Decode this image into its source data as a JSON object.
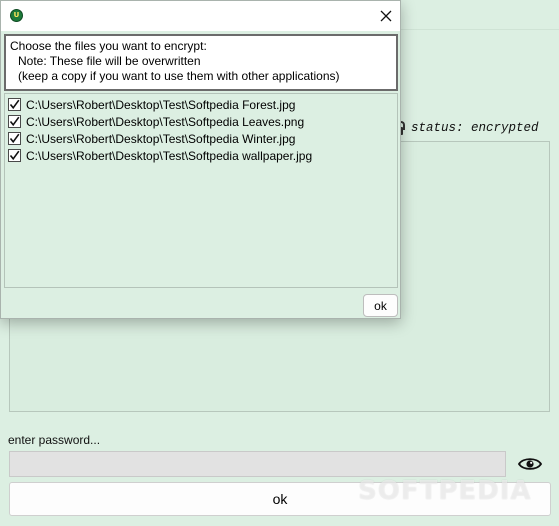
{
  "main": {
    "status_text": "status: encrypted",
    "password_label": "enter password...",
    "password_value": "",
    "ok_label": "ok",
    "watermark": "SOFTPEDIA"
  },
  "dialog": {
    "app_icon_letter": "U",
    "info_lines": [
      "Choose the files you want to encrypt:",
      "Note: These file will be overwritten",
      "(keep a copy if you want to use them with other applications)"
    ],
    "files": [
      {
        "path": "C:\\Users\\Robert\\Desktop\\Test\\Softpedia Forest.jpg",
        "checked": true
      },
      {
        "path": "C:\\Users\\Robert\\Desktop\\Test\\Softpedia Leaves.png",
        "checked": true
      },
      {
        "path": "C:\\Users\\Robert\\Desktop\\Test\\Softpedia Winter.jpg",
        "checked": true
      },
      {
        "path": "C:\\Users\\Robert\\Desktop\\Test\\Softpedia wallpaper.jpg",
        "checked": true
      }
    ],
    "ok_label": "ok"
  },
  "icons": {
    "app": "app-icon",
    "close": "close-icon",
    "lock": "lock-icon",
    "eye": "eye-icon",
    "check": "checkmark-icon"
  },
  "colors": {
    "background": "#dcefe2",
    "input_bg": "#e2e2e2",
    "app_icon": "#1d7a3a"
  }
}
